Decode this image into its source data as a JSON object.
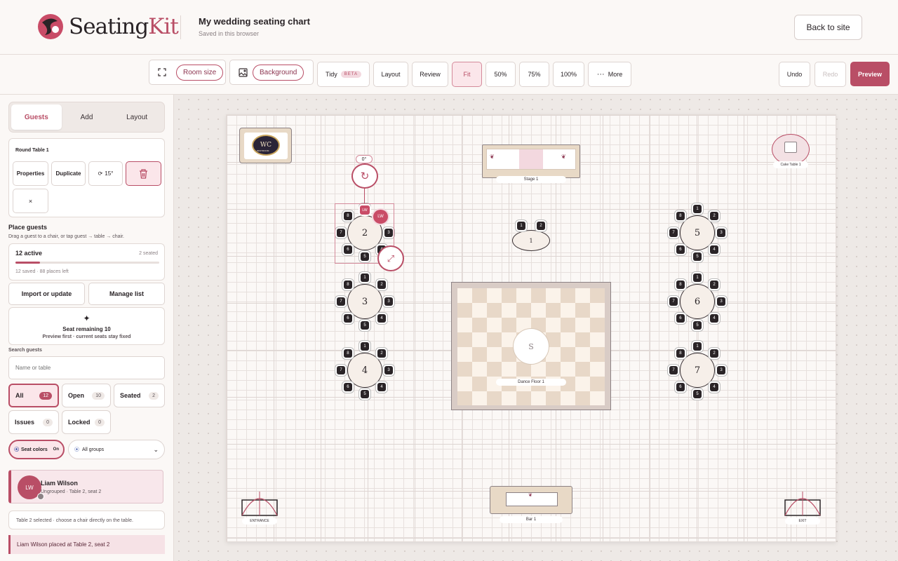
{
  "brand": {
    "name_a": "Seating",
    "name_b": "Kit"
  },
  "header": {
    "title": "My wedding seating chart",
    "subtitle": "Saved in this browser",
    "back_label": "Back to site"
  },
  "toolbar": {
    "room_size": "Room size",
    "background": "Background",
    "tidy": "Tidy",
    "beta": "BETA",
    "layout": "Layout",
    "review": "Review",
    "fit": "Fit",
    "z50": "50%",
    "z75": "75%",
    "z100": "100%",
    "more": "More",
    "undo": "Undo",
    "redo": "Redo",
    "preview": "Preview"
  },
  "sidebar": {
    "tabs": [
      "Guests",
      "Add",
      "Layout"
    ],
    "selected_title": "Round Table 1",
    "actions": {
      "properties": "Properties",
      "duplicate": "Duplicate",
      "rotate": "15°",
      "close": "×"
    },
    "place_title": "Place guests",
    "place_hint": "Drag a guest to a chair, or tap guest → table → chair.",
    "active": "12 active",
    "seated": "2 seated",
    "progress": 0.17,
    "saved": "12 saved · 88 places left",
    "import_label": "Import or update",
    "manage_label": "Manage list",
    "seat_remaining": "Seat remaining 10",
    "seat_hint": "Preview first · current seats stay fixed",
    "search_label": "Search guests",
    "search_placeholder": "Name or table",
    "filters": [
      {
        "label": "All",
        "count": "12"
      },
      {
        "label": "Open",
        "count": "10"
      },
      {
        "label": "Seated",
        "count": "2"
      },
      {
        "label": "Issues",
        "count": "0"
      },
      {
        "label": "Locked",
        "count": "0"
      }
    ],
    "seat_colors": "Seat colors",
    "seat_colors_state": "On",
    "groups": "All groups",
    "guest": {
      "initials": "LW",
      "name": "Liam Wilson",
      "detail": "Ungrouped · Table 2, seat 2"
    },
    "info": "Table 2 selected · choose a chair directly on the table.",
    "toast": "Liam Wilson placed at Table 2, seat 2"
  },
  "canvas": {
    "wc": "WC",
    "restroom": "RESTROOM",
    "stage": "Stage 1",
    "cake": "Cake Table 1",
    "dance": "Dance Floor 1",
    "bar": "Bar 1",
    "entrance": "ENTRANCE",
    "exit": "EXIT",
    "rotation": "0°",
    "badge": "LW",
    "dance_mark": "S",
    "tables": [
      "2",
      "3",
      "4",
      "5",
      "6",
      "7",
      "1"
    ]
  }
}
